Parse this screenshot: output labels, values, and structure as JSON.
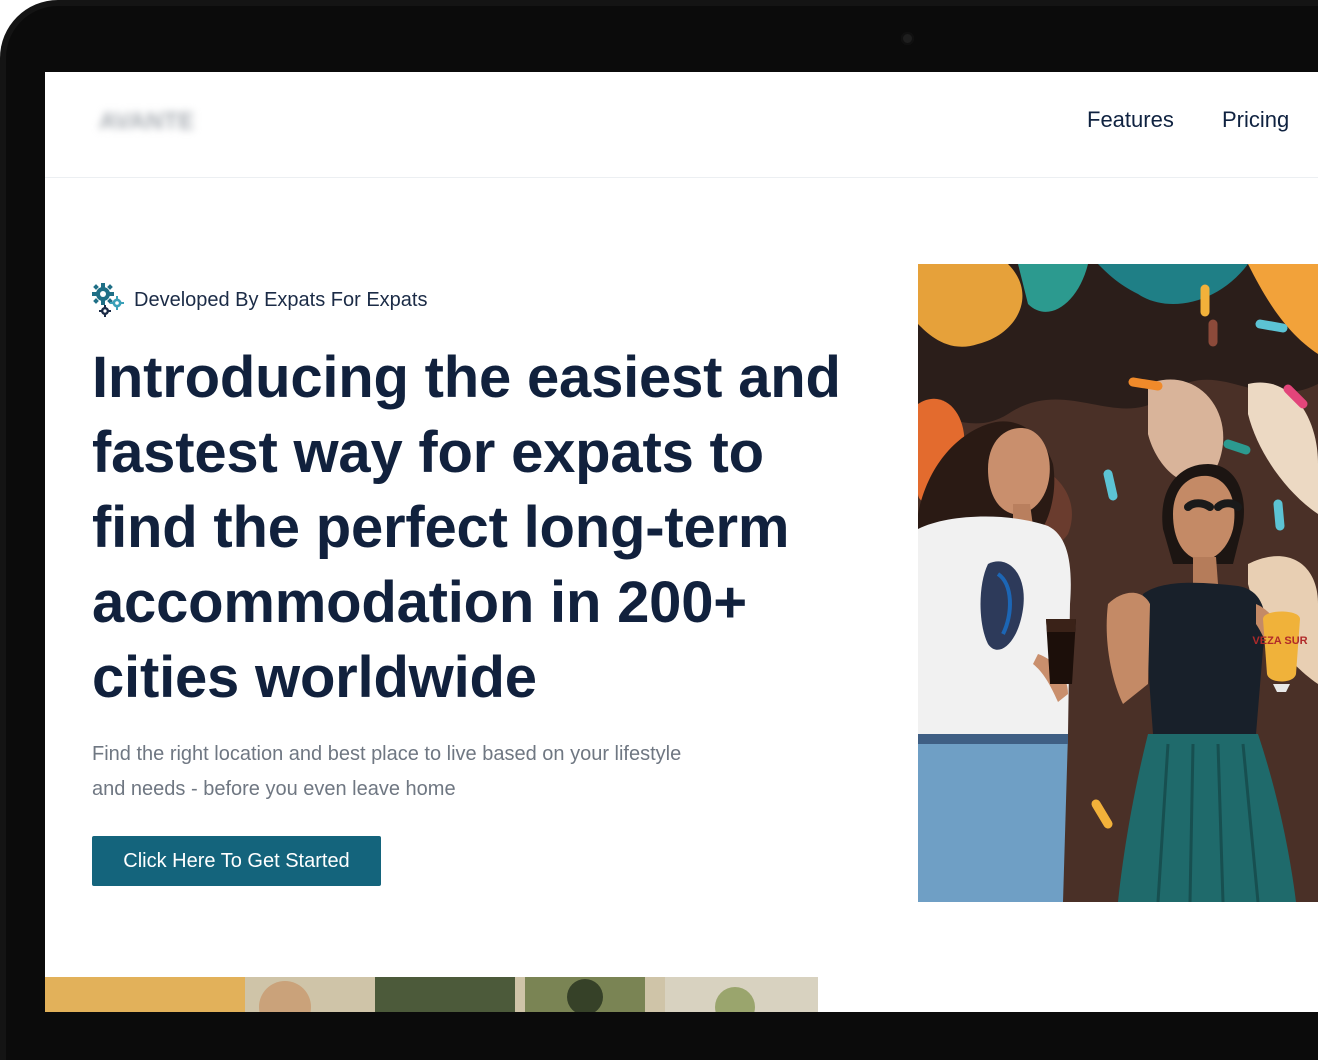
{
  "nav": {
    "logo": "AVANTE",
    "links": [
      "Features",
      "Pricing"
    ]
  },
  "hero": {
    "tagline": "Developed By Expats For Expats",
    "headline_pre": "Introducing the easiest and fastest way for ",
    "headline_highlight": "expats to find",
    "headline_post": " the perfect long-term accommodation in 200+ cities worldwide",
    "subtext": "Find the right location and best place to live based on your lifestyle and needs - before you even leave home",
    "cta_label": "Click Here To Get Started",
    "glass_label": "VEZA SUR"
  },
  "colors": {
    "primary": "#14647c",
    "heading": "#11213d",
    "highlight": "#bfe24a",
    "body_text": "#6f7782"
  },
  "icons": {
    "tagline": "gear-icon"
  }
}
